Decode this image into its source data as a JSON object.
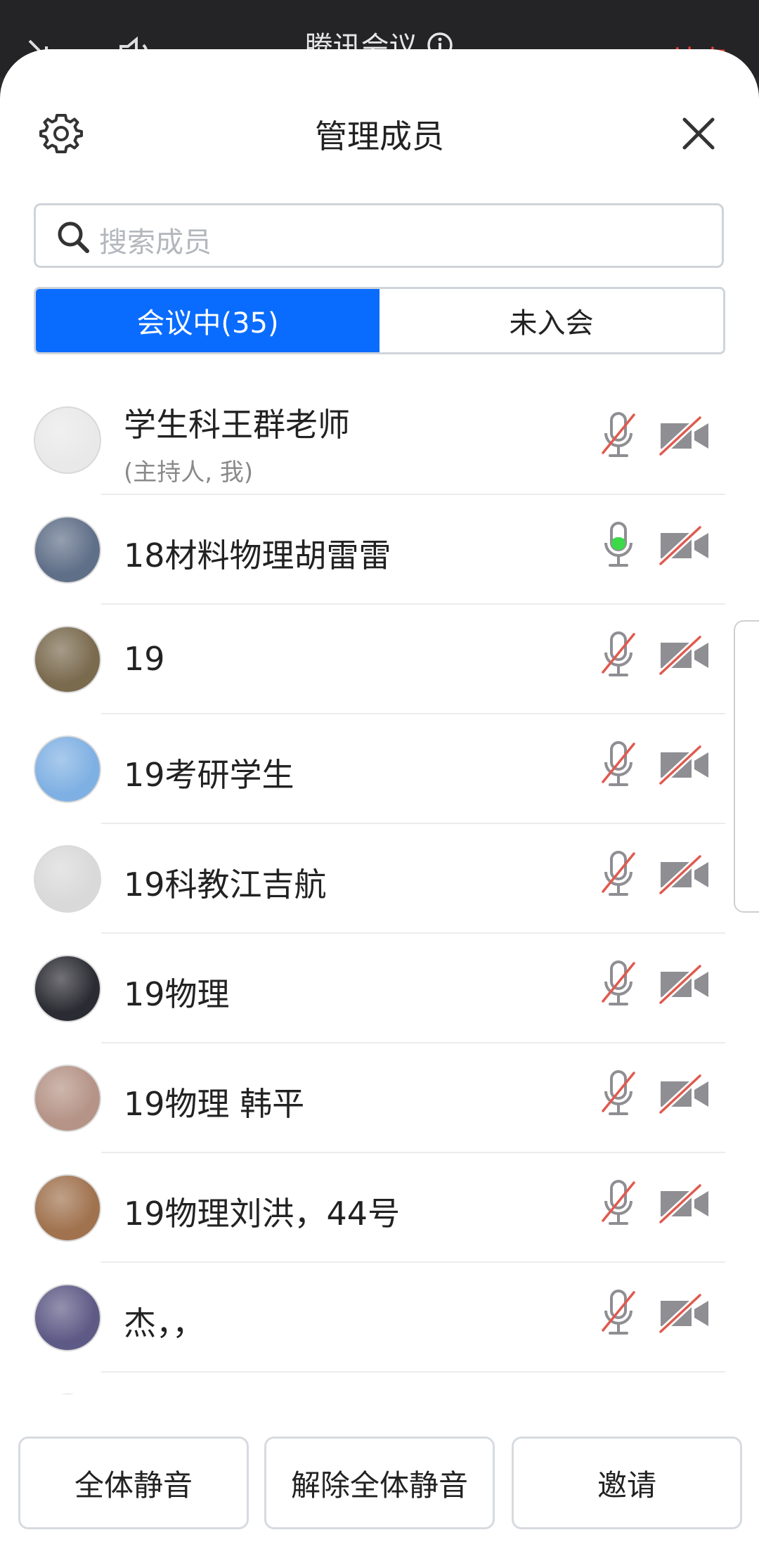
{
  "status_bar": {
    "title": "腾讯会议",
    "end_label": "结束"
  },
  "header": {
    "title": "管理成员"
  },
  "search": {
    "placeholder": "搜索成员"
  },
  "tabs": {
    "in_meeting": "会议中(35)",
    "not_joined": "未入会"
  },
  "members": [
    {
      "name": "学生科王群老师",
      "subtitle": "(主持人, 我)",
      "mic": "muted",
      "camera": "off",
      "avatar_color": "#e9e9e9"
    },
    {
      "name": "18材料物理胡雷雷",
      "subtitle": "",
      "mic": "speaking",
      "camera": "off",
      "avatar_color": "#5f6f88"
    },
    {
      "name": "19",
      "subtitle": "",
      "mic": "muted",
      "camera": "off",
      "avatar_color": "#7a6a4e"
    },
    {
      "name": "19考研学生",
      "subtitle": "",
      "mic": "muted",
      "camera": "off",
      "avatar_color": "#7fb0e3"
    },
    {
      "name": "19科教江吉航",
      "subtitle": "",
      "mic": "muted",
      "camera": "off",
      "avatar_color": "#d9d9d9"
    },
    {
      "name": "19物理",
      "subtitle": "",
      "mic": "muted",
      "camera": "off",
      "avatar_color": "#2b2b33"
    },
    {
      "name": "19物理 韩平",
      "subtitle": "",
      "mic": "muted",
      "camera": "off",
      "avatar_color": "#b59386"
    },
    {
      "name": "19物理刘洪，44号",
      "subtitle": "",
      "mic": "muted",
      "camera": "off",
      "avatar_color": "#a0724e"
    },
    {
      "name": "杰，，",
      "subtitle": "",
      "mic": "muted",
      "camera": "off",
      "avatar_color": "#5e5a86"
    },
    {
      "name": "",
      "subtitle": "",
      "mic": "muted",
      "camera": "off",
      "avatar_color": "#8a6d55"
    }
  ],
  "bottom_actions": {
    "mute_all": "全体静音",
    "unmute_all": "解除全体静音",
    "invite": "邀请"
  },
  "colors": {
    "accent": "#0a6cff",
    "speaking": "#3dd94a",
    "muted_slash": "#e05a4f",
    "icon_gray": "#8e8e93"
  }
}
